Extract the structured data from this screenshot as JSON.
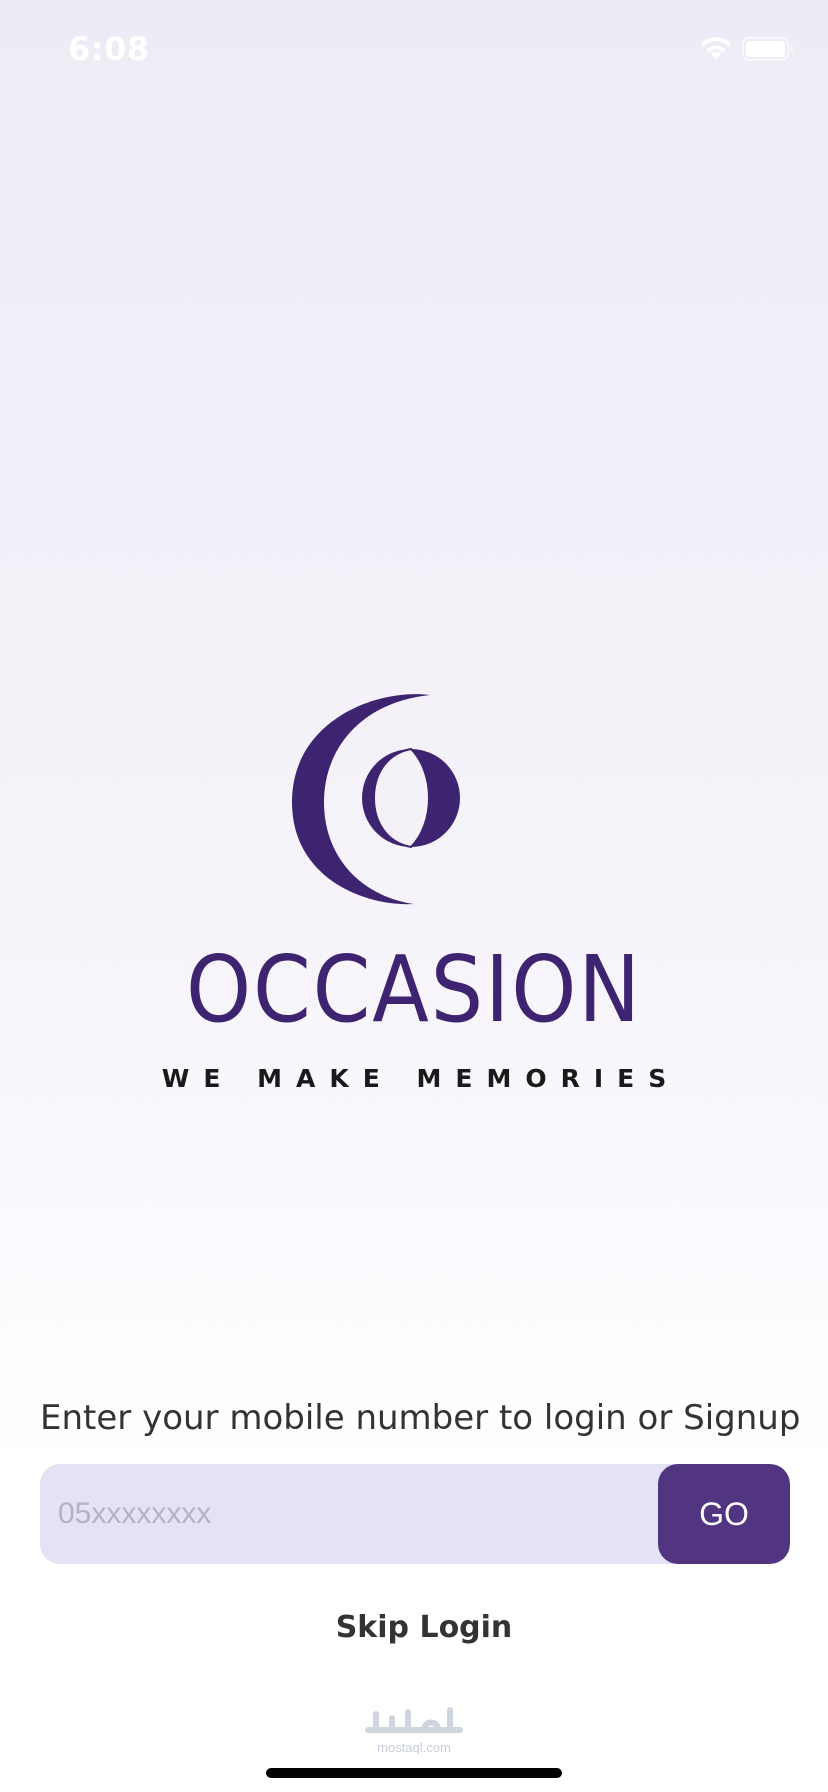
{
  "status_bar": {
    "time": "6:08",
    "wifi_icon": "wifi-icon",
    "battery_icon": "battery-icon"
  },
  "brand": {
    "logo_icon": "occasion-logo-mark",
    "name": "OCCASION",
    "tagline": "WE MAKE MEMORIES",
    "color": "#3e2470"
  },
  "login": {
    "prompt": "Enter your mobile number to login or Signup",
    "phone_value": "",
    "phone_placeholder": "05xxxxxxxx",
    "go_label": "GO",
    "go_color": "#523581",
    "field_color": "#e4e3f6",
    "skip_label": "Skip Login"
  },
  "watermark": {
    "arabic": "مستقل",
    "latin": "mostaql.com"
  }
}
